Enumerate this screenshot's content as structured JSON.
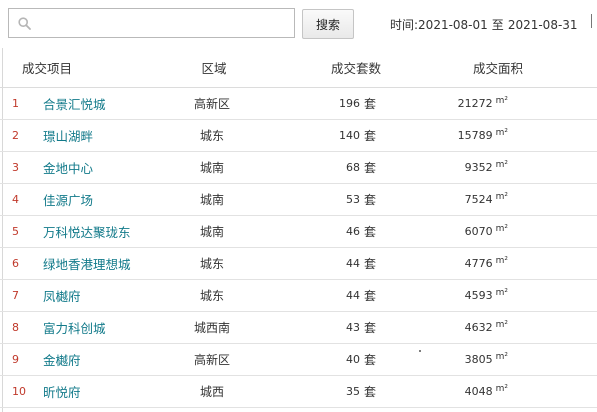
{
  "search": {
    "placeholder": "",
    "value": "",
    "button_label": "搜索"
  },
  "date_filter": {
    "label": "时间:",
    "start": "2021-08-01",
    "separator": "至",
    "end": "2021-08-31"
  },
  "table": {
    "headers": {
      "project": "成交项目",
      "area": "区域",
      "units": "成交套数",
      "size": "成交面积"
    },
    "units_suffix": "套",
    "size_suffix": "m²",
    "rows": [
      {
        "rank": "1",
        "project": "合景汇悦城",
        "area": "高新区",
        "units": "196",
        "size": "21272"
      },
      {
        "rank": "2",
        "project": "璟山湖畔",
        "area": "城东",
        "units": "140",
        "size": "15789"
      },
      {
        "rank": "3",
        "project": "金地中心",
        "area": "城南",
        "units": "68",
        "size": "9352"
      },
      {
        "rank": "4",
        "project": "佳源广场",
        "area": "城南",
        "units": "53",
        "size": "7524"
      },
      {
        "rank": "5",
        "project": "万科悦达聚珑东",
        "area": "城南",
        "units": "46",
        "size": "6070"
      },
      {
        "rank": "6",
        "project": "绿地香港理想城",
        "area": "城东",
        "units": "44",
        "size": "4776"
      },
      {
        "rank": "7",
        "project": "凤樾府",
        "area": "城东",
        "units": "44",
        "size": "4593"
      },
      {
        "rank": "8",
        "project": "富力科创城",
        "area": "城西南",
        "units": "43",
        "size": "4632"
      },
      {
        "rank": "9",
        "project": "金樾府",
        "area": "高新区",
        "units": "40",
        "size": "3805"
      },
      {
        "rank": "10",
        "project": "昕悦府",
        "area": "城西",
        "units": "35",
        "size": "4048"
      }
    ]
  },
  "colors": {
    "rank": "#c0392b",
    "project_link": "#127a8a",
    "row_border": "#e2e2e2"
  }
}
